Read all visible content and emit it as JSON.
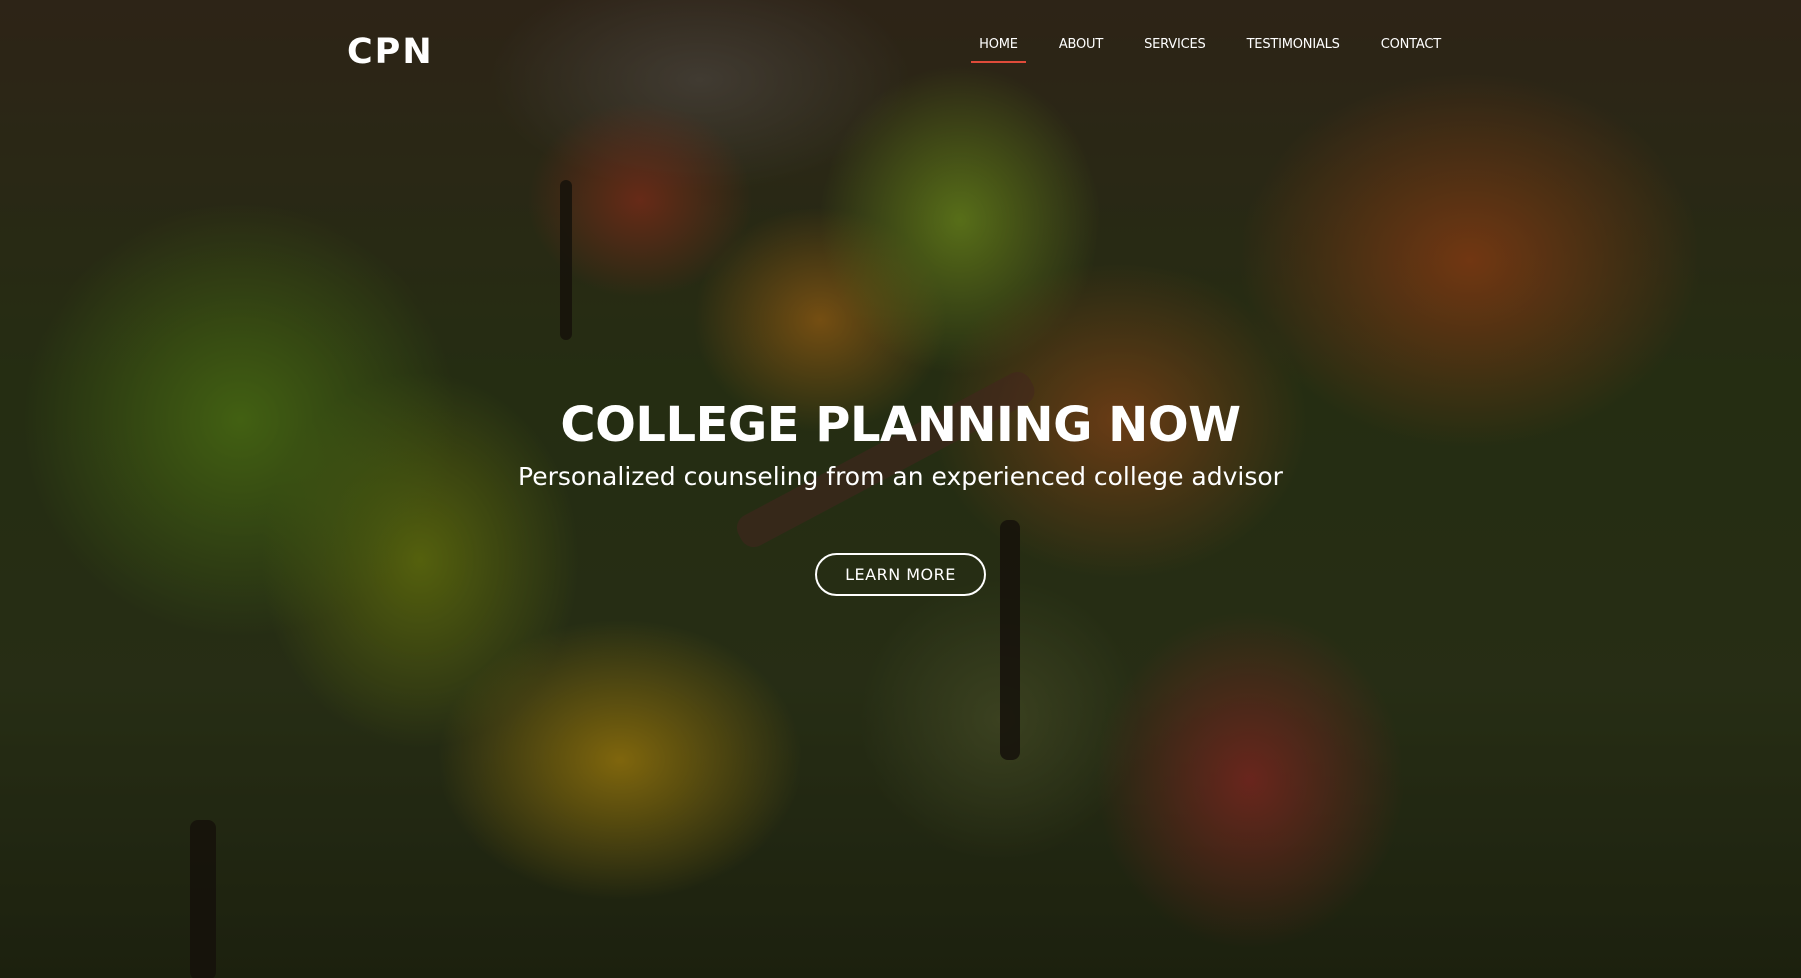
{
  "brand": {
    "logo": "CPN"
  },
  "nav": {
    "items": [
      {
        "label": "HOME",
        "active": true
      },
      {
        "label": "ABOUT",
        "active": false
      },
      {
        "label": "SERVICES",
        "active": false
      },
      {
        "label": "TESTIMONIALS",
        "active": false
      },
      {
        "label": "CONTACT",
        "active": false
      }
    ],
    "active_underline_color": "#e04b3a"
  },
  "hero": {
    "title": "COLLEGE PLANNING NOW",
    "subtitle": "Personalized counseling from an experienced college advisor",
    "cta_label": "LEARN MORE"
  }
}
